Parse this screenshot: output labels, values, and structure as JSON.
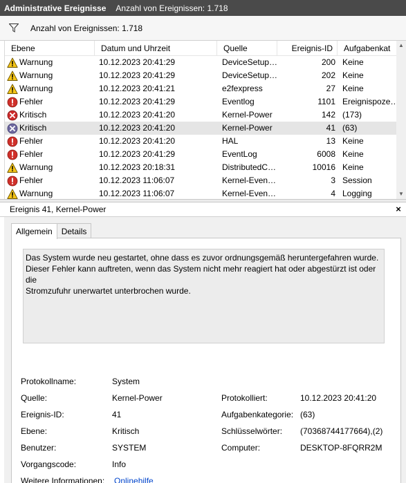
{
  "titlebar": {
    "title": "Administrative Ereignisse",
    "count": "Anzahl von Ereignissen: 1.718"
  },
  "filterbar": {
    "icon": "filter-icon",
    "text": "Anzahl von Ereignissen: 1.718"
  },
  "grid": {
    "columns": [
      "Ebene",
      "Datum und Uhrzeit",
      "Quelle",
      "Ereignis-ID",
      "Aufgabenkat"
    ],
    "rows": [
      {
        "level": "Warnung",
        "icon": "warning-icon",
        "datetime": "10.12.2023 20:41:29",
        "source": "DeviceSetup…",
        "id": "200",
        "category": "Keine"
      },
      {
        "level": "Warnung",
        "icon": "warning-icon",
        "datetime": "10.12.2023 20:41:29",
        "source": "DeviceSetup…",
        "id": "202",
        "category": "Keine"
      },
      {
        "level": "Warnung",
        "icon": "warning-icon",
        "datetime": "10.12.2023 20:41:21",
        "source": "e2fexpress",
        "id": "27",
        "category": "Keine"
      },
      {
        "level": "Fehler",
        "icon": "error-icon",
        "datetime": "10.12.2023 20:41:29",
        "source": "Eventlog",
        "id": "1101",
        "category": "Ereignispoze…"
      },
      {
        "level": "Kritisch",
        "icon": "critical-icon",
        "datetime": "10.12.2023 20:41:20",
        "source": "Kernel-Power",
        "id": "142",
        "category": "(173)"
      },
      {
        "level": "Kritisch",
        "icon": "critical-icon",
        "datetime": "10.12.2023 20:41:20",
        "source": "Kernel-Power",
        "id": "41",
        "category": "(63)",
        "selected": true
      },
      {
        "level": "Fehler",
        "icon": "error-icon",
        "datetime": "10.12.2023 20:41:20",
        "source": "HAL",
        "id": "13",
        "category": "Keine"
      },
      {
        "level": "Fehler",
        "icon": "error-icon",
        "datetime": "10.12.2023 20:41:29",
        "source": "EventLog",
        "id": "6008",
        "category": "Keine"
      },
      {
        "level": "Warnung",
        "icon": "warning-icon",
        "datetime": "10.12.2023 20:18:31",
        "source": "DistributedC…",
        "id": "10016",
        "category": "Keine"
      },
      {
        "level": "Fehler",
        "icon": "error-icon",
        "datetime": "10.12.2023 11:06:07",
        "source": "Kernel-Even…",
        "id": "3",
        "category": "Session"
      },
      {
        "level": "Warnung",
        "icon": "warning-icon",
        "datetime": "10.12.2023 11:06:07",
        "source": "Kernel-Even…",
        "id": "4",
        "category": "Logging"
      }
    ]
  },
  "detail": {
    "header": "Ereignis 41, Kernel-Power",
    "close_label": "×",
    "tabs": [
      "Allgemein",
      "Details"
    ],
    "message": "Das System wurde neu gestartet, ohne dass es zuvor ordnungsgemäß heruntergefahren wurde.\nDieser Fehler kann auftreten, wenn das System nicht mehr reagiert hat oder abgestürzt ist oder die\nStromzufuhr unerwartet unterbrochen wurde.",
    "props": {
      "log_name_label": "Protokollname:",
      "log_name": "System",
      "source_label": "Quelle:",
      "source": "Kernel-Power",
      "logged_label": "Protokolliert:",
      "logged": "10.12.2023 20:41:20",
      "event_id_label": "Ereignis-ID:",
      "event_id": "41",
      "task_category_label": "Aufgabenkategorie:",
      "task_category": "(63)",
      "level_label": "Ebene:",
      "level": "Kritisch",
      "keywords_label": "Schlüsselwörter:",
      "keywords": "(70368744177664),(2)",
      "user_label": "Benutzer:",
      "user": "SYSTEM",
      "computer_label": "Computer:",
      "computer": "DESKTOP-8FQRR2M",
      "opcode_label": "Vorgangscode:",
      "opcode": "Info",
      "more_info_label": "Weitere Informationen:",
      "more_info_link": "Onlinehilfe"
    }
  }
}
